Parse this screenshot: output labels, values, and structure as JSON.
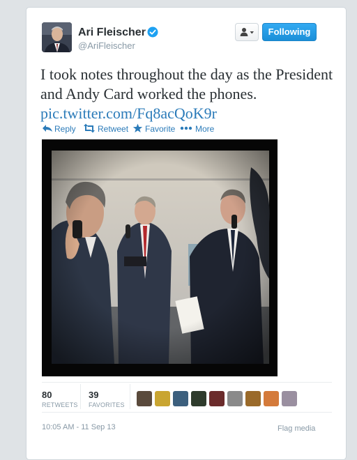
{
  "user": {
    "name": "Ari Fleischer",
    "handle": "@AriFleischer",
    "verified": true
  },
  "header": {
    "user_menu_icon": "user-dropdown-icon",
    "follow_label": "Following"
  },
  "tweet": {
    "text": "I took notes throughout the day as the President and Andy Card worked the phones.",
    "link": "pic.twitter.com/Fq8acQoK9r"
  },
  "actions": [
    {
      "label": "Reply",
      "icon": "reply-icon"
    },
    {
      "label": "Retweet",
      "icon": "retweet-icon"
    },
    {
      "label": "Favorite",
      "icon": "star-icon"
    },
    {
      "label": "More",
      "icon": "more-dots-icon"
    }
  ],
  "stats": {
    "retweets": {
      "count": "80",
      "label": "RETWEETS"
    },
    "favorites": {
      "count": "39",
      "label": "FAVORITES"
    }
  },
  "footer": {
    "timestamp": "10:05 AM - 11 Sep 13",
    "flag_label": "Flag media"
  },
  "colors": {
    "link": "#2b7bb9",
    "follow_button": "#1b8fd8",
    "verified": "#1da1f2",
    "muted": "#8899a6"
  }
}
